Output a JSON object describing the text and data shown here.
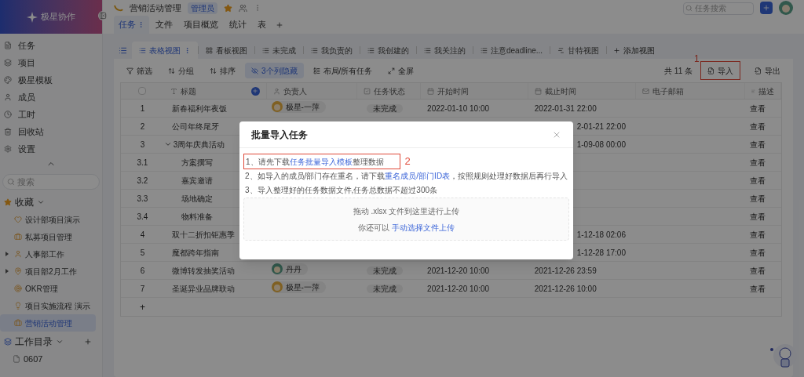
{
  "app": {
    "name": "极星协作"
  },
  "sidebar": {
    "nav": [
      {
        "label": "任务"
      },
      {
        "label": "项目"
      },
      {
        "label": "极星模板"
      },
      {
        "label": "成员"
      },
      {
        "label": "工时"
      },
      {
        "label": "回收站"
      },
      {
        "label": "设置"
      }
    ],
    "search": {
      "placeholder": "搜索"
    },
    "favorites": {
      "label": "收藏",
      "expanded": true,
      "items": [
        {
          "label": "设计部项目演示",
          "kind": "project",
          "selected": false
        },
        {
          "label": "私募项目管理",
          "kind": "project",
          "selected": false
        },
        {
          "label": "人事部工作",
          "kind": "folder",
          "selected": false
        },
        {
          "label": "项目部2月工作",
          "kind": "folder",
          "selected": false
        },
        {
          "label": "OKR管理",
          "kind": "project",
          "selected": false
        },
        {
          "label": "项目实施流程 演示",
          "kind": "project",
          "selected": false
        },
        {
          "label": "营销活动管理",
          "kind": "project",
          "selected": true
        }
      ]
    },
    "directory": {
      "label": "工作目录",
      "expanded": true,
      "items": [
        {
          "label": "0607"
        }
      ]
    }
  },
  "header": {
    "project": "营销活动管理",
    "role": "管理员",
    "starred": true,
    "tabs": [
      {
        "label": "任务",
        "selected": true
      },
      {
        "label": "文件",
        "selected": false
      },
      {
        "label": "项目概览",
        "selected": false
      },
      {
        "label": "统计",
        "selected": false
      },
      {
        "label": "表",
        "selected": false
      }
    ],
    "search": {
      "placeholder": "任务搜索"
    }
  },
  "views": [
    {
      "label": "表格视图",
      "kind": "table",
      "selected": true
    },
    {
      "label": "看板视图",
      "kind": "board",
      "selected": false
    },
    {
      "label": "未完成",
      "kind": "list",
      "selected": false
    },
    {
      "label": "我负责的",
      "kind": "list",
      "selected": false
    },
    {
      "label": "我创建的",
      "kind": "list",
      "selected": false
    },
    {
      "label": "我关注的",
      "kind": "list",
      "selected": false
    },
    {
      "label": "注意deadline...",
      "kind": "list",
      "selected": false
    },
    {
      "label": "甘特视图",
      "kind": "gantt",
      "selected": false
    }
  ],
  "add_view": "添加视图",
  "toolbar": {
    "left": [
      {
        "label": "筛选",
        "active": false
      },
      {
        "label": "分组",
        "active": false
      },
      {
        "label": "排序",
        "active": false
      },
      {
        "label": "3个列隐藏",
        "active": true
      },
      {
        "label": "布局/所有任务",
        "active": false
      },
      {
        "label": "全屏",
        "active": false
      }
    ],
    "count": "共 11 条",
    "import": {
      "label": "导入",
      "marker": "1"
    },
    "export": "导出"
  },
  "table": {
    "select_all": {
      "checked": false
    },
    "columns": [
      "标题",
      "负责人",
      "任务状态",
      "开始时间",
      "截止时间",
      "电子邮箱",
      "描述"
    ],
    "rows": [
      {
        "no": "1",
        "title": "新春福利年夜饭",
        "assignee": "极星-一萍",
        "status": "未完成",
        "start": "2022-01-10 10:00",
        "deadline": "2022-01-31 22:00",
        "desc": "查看"
      },
      {
        "no": "2",
        "title": "公司年终尾牙",
        "deadline": "2-01-21 22:00",
        "desc": "查看"
      },
      {
        "no": "3",
        "title": "3周年庆典活动",
        "deadline": "1-09-08 00:00",
        "desc": "查看",
        "expanded": true,
        "children": [
          {
            "no": "3.1",
            "title": "方案撰写",
            "desc": "查看"
          },
          {
            "no": "3.2",
            "title": "嘉宾邀请",
            "desc": "查看"
          },
          {
            "no": "3.3",
            "title": "场地确定",
            "desc": "查看"
          },
          {
            "no": "3.4",
            "title": "物料准备",
            "desc": "查看"
          }
        ]
      },
      {
        "no": "4",
        "title": "双十二折扣钜惠季",
        "deadline": "1-12-18 02:06",
        "desc": "查看"
      },
      {
        "no": "5",
        "title": "魔都跨年指南",
        "deadline": "1-12-28 17:00",
        "desc": "查看"
      },
      {
        "no": "6",
        "title": "微博转发抽奖活动",
        "assignee": "丹丹",
        "status": "未完成",
        "start": "2021-12-20 10:00",
        "deadline": "2021-12-26 23:59",
        "desc": "查看"
      },
      {
        "no": "7",
        "title": "圣诞异业品牌联动",
        "assignee": "极星-一萍",
        "status": "未完成",
        "start": "2021-12-20 10:00",
        "deadline": "2021-12-26 10:00",
        "desc": "查看"
      }
    ],
    "add_row": "+"
  },
  "dialog": {
    "title": "批量导入任务",
    "steps": [
      {
        "before": "1、请先下载",
        "link": "任务批量导入模板",
        "after": "整理数据",
        "marker": "2"
      },
      {
        "before": "2、如导入的成员/部门存在重名，请下载",
        "link": "重名成员/部门ID表",
        "after": "，按照规则处理好数据后再行导入"
      },
      {
        "before": "3、导入整理好的任务数据文件,任务总数据不超过300条"
      }
    ],
    "drop": {
      "hint": "拖动 .xlsx 文件到这里进行上传",
      "alt": "你还可以",
      "link": "手动选择文件上传"
    }
  }
}
